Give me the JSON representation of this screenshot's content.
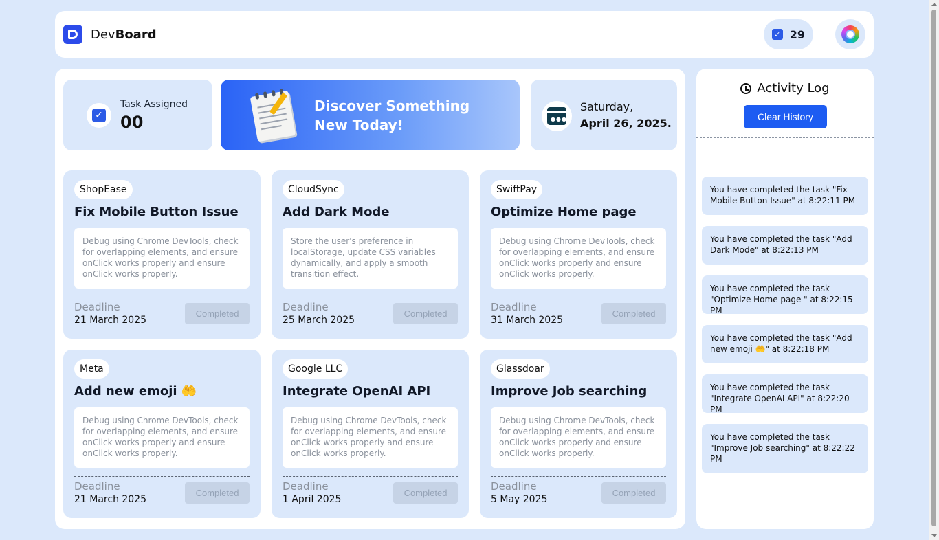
{
  "header": {
    "brand_light": "Dev",
    "brand_bold": "Board",
    "task_count": "29"
  },
  "stats": {
    "task_assigned_label": "Task Assigned",
    "task_assigned_value": "00",
    "banner_text": "Discover Something New Today!",
    "date_day": "Saturday,",
    "date_full": "April 26, 2025."
  },
  "tasks": [
    {
      "company": "ShopEase",
      "title": "Fix Mobile Button Issue",
      "description": "Debug using Chrome DevTools, check for overlapping elements, and ensure onClick works properly and ensure onClick works properly.",
      "deadline_label": "Deadline",
      "deadline": "21 March 2025",
      "status": "Completed"
    },
    {
      "company": "CloudSync",
      "title": "Add Dark Mode",
      "description": "Store the user's preference in localStorage, update CSS variables dynamically, and apply a smooth transition effect.",
      "deadline_label": "Deadline",
      "deadline": "25 March 2025",
      "status": "Completed"
    },
    {
      "company": "SwiftPay",
      "title": "Optimize Home page",
      "description": "Debug using Chrome DevTools, check for overlapping elements, and ensure onClick works properly and ensure onClick works properly.",
      "deadline_label": "Deadline",
      "deadline": "31 March 2025",
      "status": "Completed"
    },
    {
      "company": "Meta",
      "title": "Add new emoji 🤲",
      "description": "Debug using Chrome DevTools, check for overlapping elements, and ensure onClick works properly and ensure onClick works properly.",
      "deadline_label": "Deadline",
      "deadline": "21 March 2025",
      "status": "Completed"
    },
    {
      "company": "Google LLC",
      "title": "Integrate OpenAI API",
      "description": "Debug using Chrome DevTools, check for overlapping elements, and ensure onClick works properly and ensure onClick works properly.",
      "deadline_label": "Deadline",
      "deadline": "1 April 2025",
      "status": "Completed"
    },
    {
      "company": "Glassdoar",
      "title": "Improve Job searching",
      "description": "Debug using Chrome DevTools, check for overlapping elements, and ensure onClick works properly and ensure onClick works properly.",
      "deadline_label": "Deadline",
      "deadline": "5 May 2025",
      "status": "Completed"
    }
  ],
  "activity": {
    "title": "Activity Log",
    "clear_label": "Clear History",
    "items": [
      "You have completed the task \"Fix Mobile Button Issue\" at 8:22:11 PM",
      "You have completed the task \"Add Dark Mode\" at 8:22:13 PM",
      "You have completed the task \"Optimize Home page \" at 8:22:15 PM",
      "You have completed the task \"Add new emoji 🤲\" at 8:22:18 PM",
      "You have completed the task \"Integrate OpenAI API\" at 8:22:20 PM",
      "You have completed the task \"Improve Job searching\" at 8:22:22 PM"
    ]
  }
}
